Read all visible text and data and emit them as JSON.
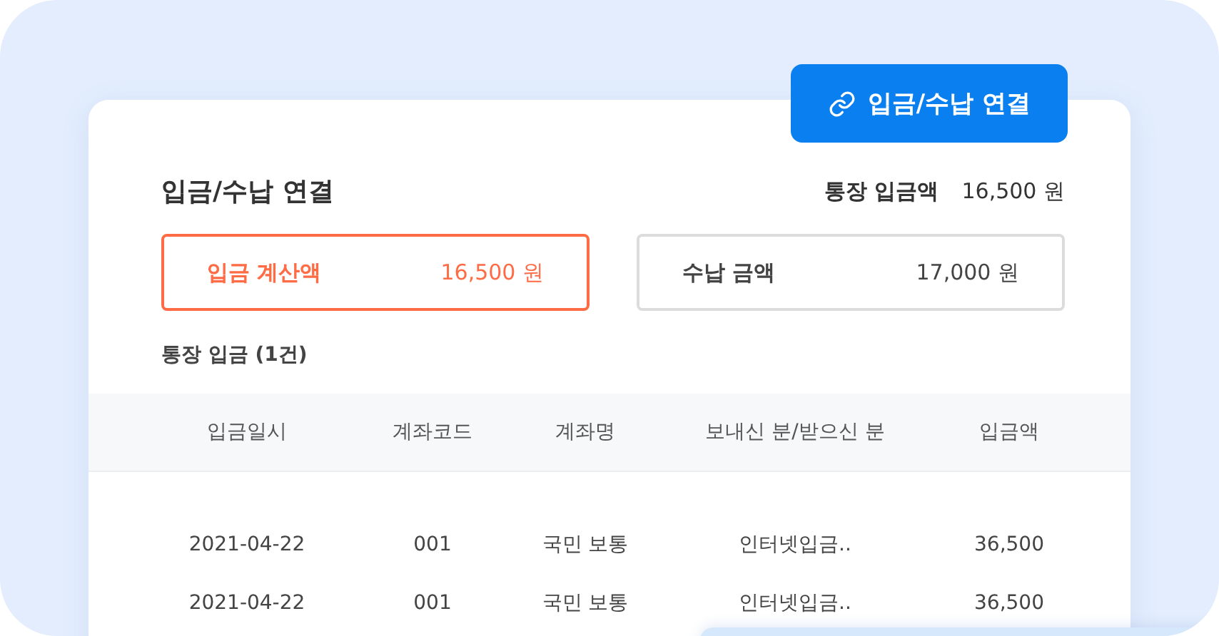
{
  "link_button": {
    "label": "입금/수납 연결"
  },
  "title": "입금/수납 연결",
  "bank_deposit": {
    "label": "통장 입금액",
    "value": "16,500 원"
  },
  "amounts": [
    {
      "label": "입금 계산액",
      "value": "16,500 원",
      "selected": true
    },
    {
      "label": "수납 금액",
      "value": "17,000 원",
      "selected": false
    }
  ],
  "section_title": "통장 입금 (1건)",
  "table": {
    "columns": [
      "입금일시",
      "계좌코드",
      "계좌명",
      "보내신 분/받으신 분",
      "입금액"
    ],
    "rows": [
      [
        "2021-04-22",
        "001",
        "국민 보통",
        "인터넷입금..",
        "36,500"
      ],
      [
        "2021-04-22",
        "001",
        "국민 보통",
        "인터넷입금..",
        "36,500"
      ]
    ]
  }
}
